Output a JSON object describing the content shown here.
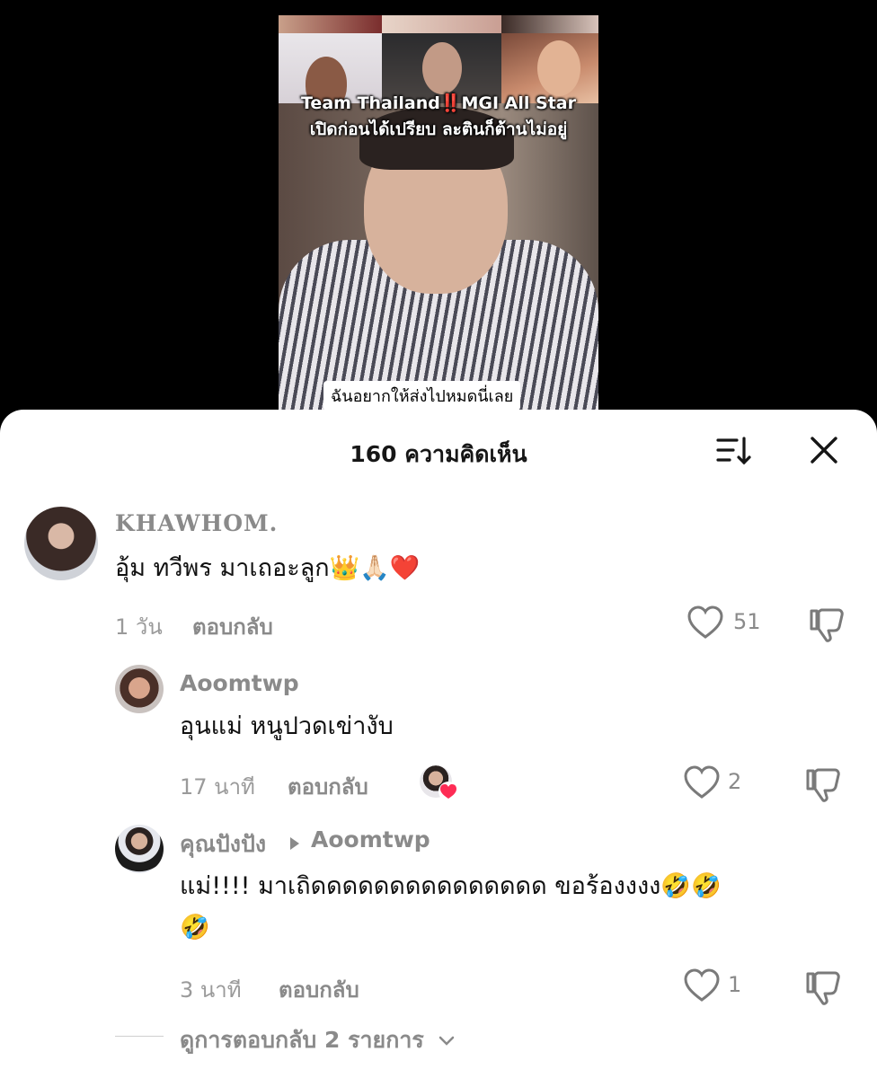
{
  "video": {
    "title_line1": "Team Thailand‼️MGI All Star",
    "title_line2": "เปิดก่อนได้เปรียบ ละตินก็ต้านไม่อยู่",
    "caption": "ฉันอยากให้ส่งไปหมดนี่เลย"
  },
  "header": {
    "title": "160 ความคิดเห็น",
    "sort_icon": "sort-icon",
    "close_icon": "close-icon"
  },
  "comments": [
    {
      "username": "KHAWHOM.",
      "text": "อุ้ม ทวีพร มาเถอะลูก👑🙏🏻❤️",
      "time": "1 วัน",
      "reply_label": "ตอบกลับ",
      "likes": "51"
    },
    {
      "username": "Aoomtwp",
      "text": "อุนแม่ หนูปวดเข่างับ",
      "time": "17 นาที",
      "reply_label": "ตอบกลับ",
      "likes": "2"
    },
    {
      "username": "คุณปังปัง",
      "reply_to": "Aoomtwp",
      "text_line1": "แม่!!!! มาเถิดดดดดดดดดดดดดดด ขอร้องงงง🤣🤣",
      "text_line2": "🤣",
      "time": "3 นาที",
      "reply_label": "ตอบกลับ",
      "likes": "1"
    }
  ],
  "view_more": "ดูการตอบกลับ 2 รายการ",
  "colors": {
    "heart_badge": "#fe2c55",
    "sheet_bg": "#ffffff",
    "backdrop": "#000000"
  }
}
